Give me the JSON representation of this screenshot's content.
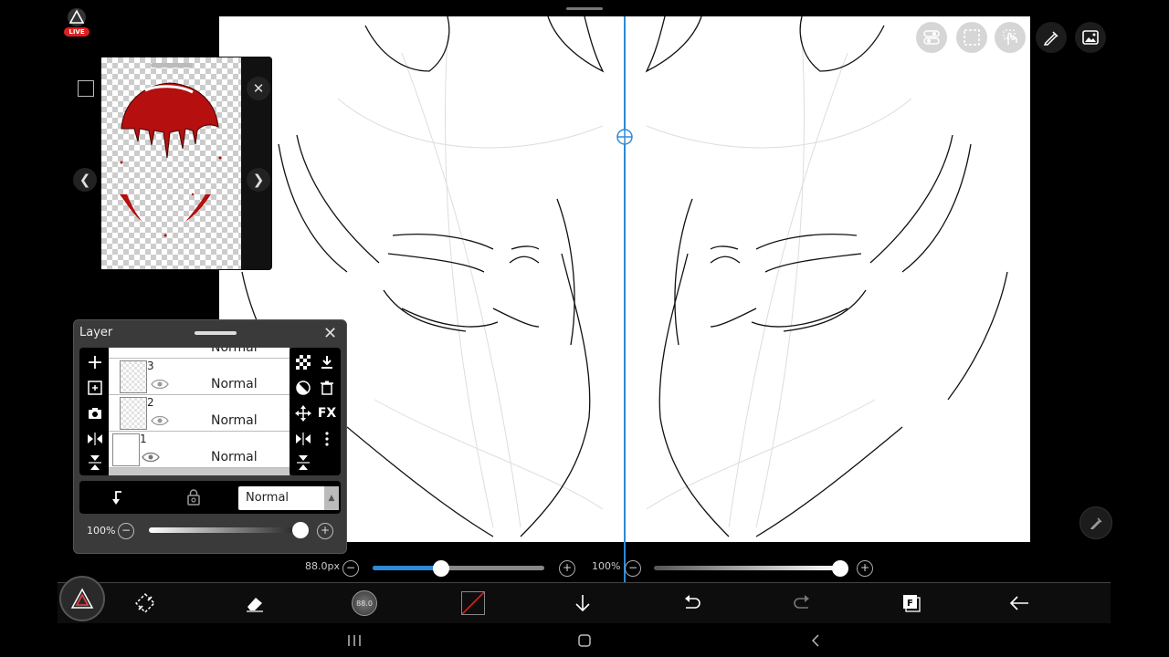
{
  "live_badge": "LIVE",
  "layer_panel": {
    "title": "Layer",
    "partial_row_blend": "Normal",
    "layers": [
      {
        "number": "3",
        "blend": "Normal"
      },
      {
        "number": "2",
        "blend": "Normal"
      },
      {
        "number": "1",
        "blend": "Normal"
      }
    ],
    "blend_mode_selected": "Normal",
    "opacity_label": "100%",
    "opacity_value": 1.0,
    "fx_label": "FX"
  },
  "brush_size_label": "88.0px",
  "brush_size_value": 0.4,
  "brush_opacity_label": "100%",
  "brush_opacity_value": 1.0,
  "toolbar": {
    "brush_size_display": "88.0"
  },
  "colors": {
    "accent_blue": "#2e8ad8",
    "reference_red": "#b50f0f",
    "panel_bg": "#3a3a3a"
  }
}
